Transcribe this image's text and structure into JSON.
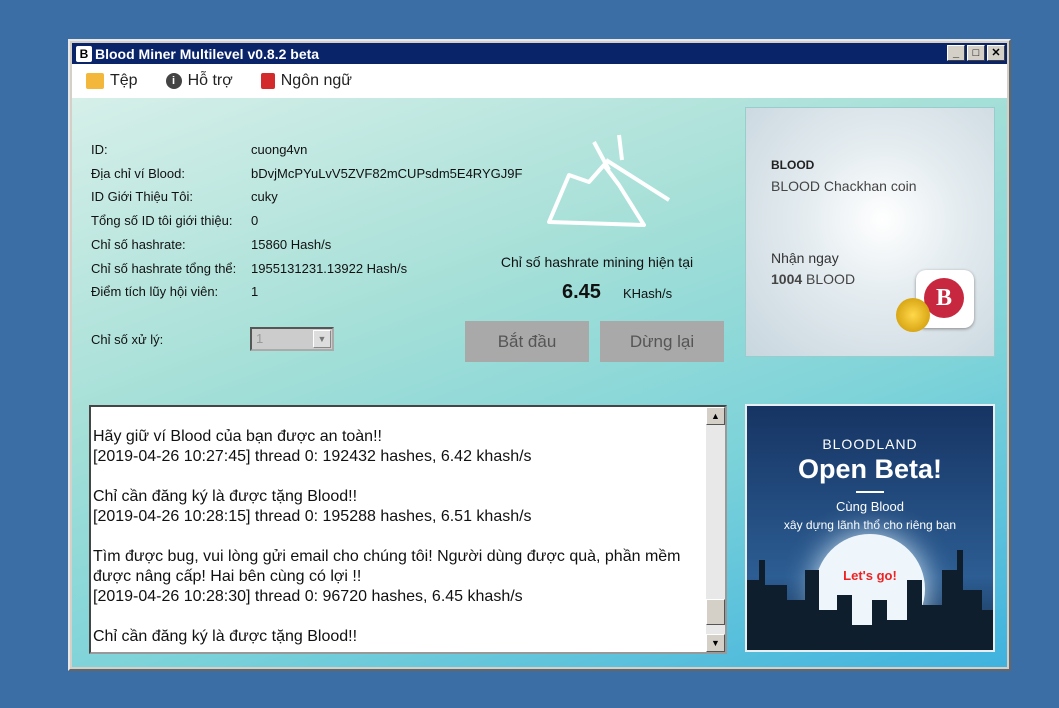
{
  "window": {
    "title": "Blood Miner Multilevel v0.8.2 beta",
    "app_icon": "blood-logo"
  },
  "menu": [
    {
      "label": "Tệp",
      "icon": "folder-icon"
    },
    {
      "label": "Hỗ trợ",
      "icon": "info-icon"
    },
    {
      "label": "Ngôn ngữ",
      "icon": "book-icon"
    }
  ],
  "info": [
    {
      "label": "ID:",
      "value": "cuong4vn"
    },
    {
      "label": "Địa chỉ ví Blood:",
      "value": "bDvjMcPYuLvV5ZVF82mCUPsdm5E4RYGJ9F"
    },
    {
      "label": "ID Giới Thiệu Tôi:",
      "value": "cuky"
    },
    {
      "label": "Tổng số ID tôi giới thiệu:",
      "value": "0"
    },
    {
      "label": "Chỉ số hashrate:",
      "value": "15860 Hash/s"
    },
    {
      "label": "Chỉ số hashrate tổng thể:",
      "value": "1955131231.13922 Hash/s"
    },
    {
      "label": "Điểm tích lũy hội viên:",
      "value": "1"
    }
  ],
  "processor": {
    "label": "Chỉ số xử lý:",
    "value": "1"
  },
  "mining": {
    "title": "Chỉ số hashrate mining hiện tại",
    "value": "6.45",
    "unit": "KHash/s"
  },
  "buttons": {
    "start": "Bắt đầu",
    "stop": "Dừng lại"
  },
  "log": [
    "Hãy giữ ví Blood của bạn được an toàn!!",
    "[2019-04-26 10:27:45] thread 0: 192432 hashes, 6.42 khash/s",
    "",
    "Chỉ cần đăng ký là được tặng Blood!!",
    "[2019-04-26 10:28:15] thread 0: 195288 hashes, 6.51 khash/s",
    "",
    "Tìm được bug, vui lòng gửi email cho chúng tôi! Người dùng được quà, phần mềm được nâng cấp! Hai bên cùng có lợi !!",
    "[2019-04-26 10:28:30] thread 0: 96720 hashes, 6.45 khash/s",
    "",
    "Chỉ cần đăng ký là được tặng Blood!!"
  ],
  "ad1": {
    "brand": "BLOOD",
    "subtitle": "BLOOD Chackhan coin",
    "line1": "Nhận ngay",
    "amount": "1004",
    "amount_unit": "BLOOD"
  },
  "ad2": {
    "brand": "BLOODLAND",
    "headline": "Open Beta!",
    "line1": "Cùng Blood",
    "line2": "xây dựng lãnh thổ cho riêng bạn",
    "cta": "Let's go!"
  }
}
